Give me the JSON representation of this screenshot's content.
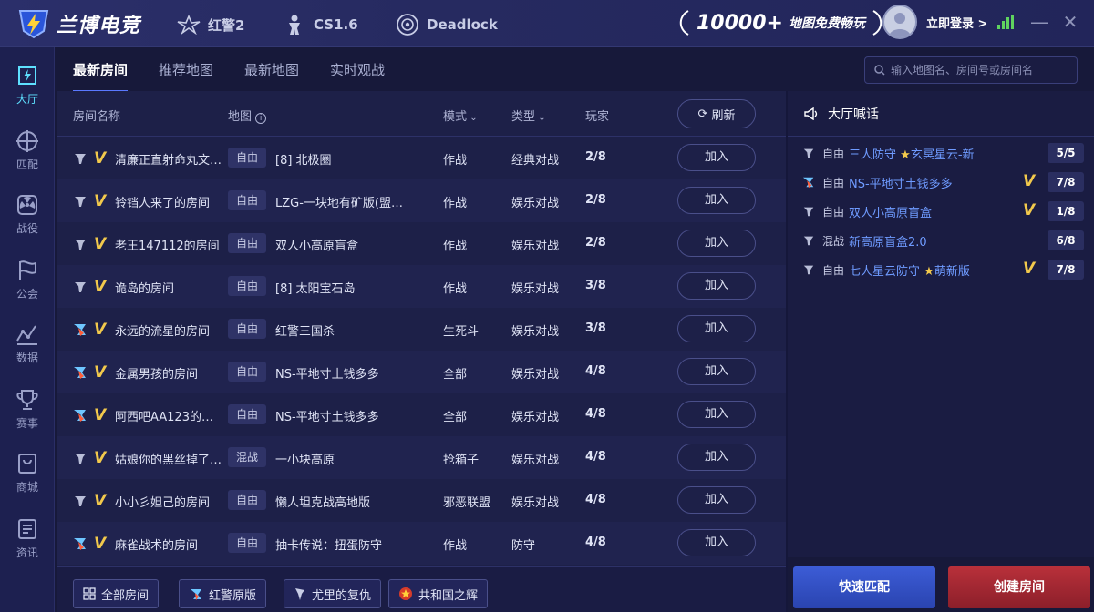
{
  "app": {
    "brand": "兰博电竞"
  },
  "header": {
    "game_tabs": [
      {
        "label": "红警2",
        "icon": "red-alert-wings-icon"
      },
      {
        "label": "CS1.6",
        "icon": "cs-soldier-icon"
      },
      {
        "label": "Deadlock",
        "icon": "deadlock-eye-icon"
      }
    ],
    "promo": {
      "number": "10000+",
      "text": "地图免费畅玩"
    },
    "login_label": "立即登录 >",
    "accent_color": "#5ee0ff"
  },
  "sidebar": {
    "items": [
      {
        "label": "大厅",
        "icon": "lightning-box-icon",
        "active": true
      },
      {
        "label": "匹配",
        "icon": "crosshair-icon",
        "active": false
      },
      {
        "label": "战役",
        "icon": "radiation-icon",
        "active": false
      },
      {
        "label": "公会",
        "icon": "flag-icon",
        "active": false
      },
      {
        "label": "数据",
        "icon": "line-chart-icon",
        "active": false
      },
      {
        "label": "赛事",
        "icon": "trophy-icon",
        "active": false
      },
      {
        "label": "商城",
        "icon": "shopping-bag-icon",
        "active": false
      },
      {
        "label": "资讯",
        "icon": "news-icon",
        "active": false
      }
    ]
  },
  "subtabs": [
    "最新房间",
    "推荐地图",
    "最新地图",
    "实时观战"
  ],
  "search": {
    "placeholder": "输入地图名、房间号或房间名"
  },
  "table": {
    "headers": {
      "name": "房间名称",
      "map": "地图",
      "mode": "模式",
      "type": "类型",
      "players": "玩家"
    },
    "refresh_label": "刷新",
    "join_label": "加入",
    "rows": [
      {
        "faction": "allied",
        "name": "清廉正直射命丸文…",
        "tag": "自由",
        "map": "[8] 北极圈",
        "mode": "作战",
        "type": "经典对战",
        "players": "2/8"
      },
      {
        "faction": "allied",
        "name": "铃铛人来了的房间",
        "tag": "自由",
        "map": "LZG-一块地有矿版(盟…",
        "mode": "作战",
        "type": "娱乐对战",
        "players": "2/8"
      },
      {
        "faction": "allied",
        "name": "老王147112的房间",
        "tag": "自由",
        "map": "双人小高原盲盒",
        "mode": "作战",
        "type": "娱乐对战",
        "players": "2/8"
      },
      {
        "faction": "allied",
        "name": "诡岛的房间",
        "tag": "自由",
        "map": "[8] 太阳宝石岛",
        "mode": "作战",
        "type": "娱乐对战",
        "players": "3/8"
      },
      {
        "faction": "mixed",
        "name": "永远的流星的房间",
        "tag": "自由",
        "map": "红警三国杀",
        "mode": "生死斗",
        "type": "娱乐对战",
        "players": "3/8"
      },
      {
        "faction": "mixed",
        "name": "金属男孩的房间",
        "tag": "自由",
        "map": "NS-平地寸土钱多多",
        "mode": "全部",
        "type": "娱乐对战",
        "players": "4/8"
      },
      {
        "faction": "mixed",
        "name": "阿西吧AA123的房间",
        "tag": "自由",
        "map": "NS-平地寸土钱多多",
        "mode": "全部",
        "type": "娱乐对战",
        "players": "4/8"
      },
      {
        "faction": "allied",
        "name": "姑娘你的黑丝掉了…",
        "tag": "混战",
        "map": "一小块高原",
        "mode": "抢箱子",
        "type": "娱乐对战",
        "players": "4/8"
      },
      {
        "faction": "allied",
        "name": "小小彡妲己的房间",
        "tag": "自由",
        "map": "懒人坦克战高地版",
        "mode": "邪恶联盟",
        "type": "娱乐对战",
        "players": "4/8"
      },
      {
        "faction": "mixed",
        "name": "麻雀战术的房间",
        "tag": "自由",
        "map": "抽卡传说：扭蛋防守",
        "mode": "作战",
        "type": "防守",
        "players": "4/8"
      }
    ]
  },
  "filters": [
    {
      "label": "全部房间",
      "icon": "grid-icon"
    },
    {
      "label": "红警原版",
      "icon": "red-alert-icon"
    },
    {
      "label": "尤里的复仇",
      "icon": "yuri-icon"
    },
    {
      "label": "共和国之辉",
      "icon": "star-emblem-icon"
    }
  ],
  "chat": {
    "title": "大厅喊话",
    "items": [
      {
        "faction": "allied",
        "tag": "自由",
        "name_a": "三人防守",
        "star": true,
        "name_b": "玄冥星云-新",
        "vip": false,
        "count": "5/5"
      },
      {
        "faction": "mixed",
        "tag": "自由",
        "name_a": "NS-平地寸土钱多多",
        "star": false,
        "name_b": "",
        "vip": true,
        "count": "7/8"
      },
      {
        "faction": "allied",
        "tag": "自由",
        "name_a": "双人小高原盲盒",
        "star": false,
        "name_b": "",
        "vip": true,
        "count": "1/8"
      },
      {
        "faction": "allied",
        "tag": "混战",
        "name_a": "新高原盲盒2.0",
        "star": false,
        "name_b": "",
        "vip": false,
        "count": "6/8"
      },
      {
        "faction": "allied",
        "tag": "自由",
        "name_a": "七人星云防守",
        "star": true,
        "name_b": "萌新版",
        "vip": true,
        "count": "7/8"
      }
    ]
  },
  "actions": {
    "quick_match": "快速匹配",
    "create_room": "创建房间"
  }
}
